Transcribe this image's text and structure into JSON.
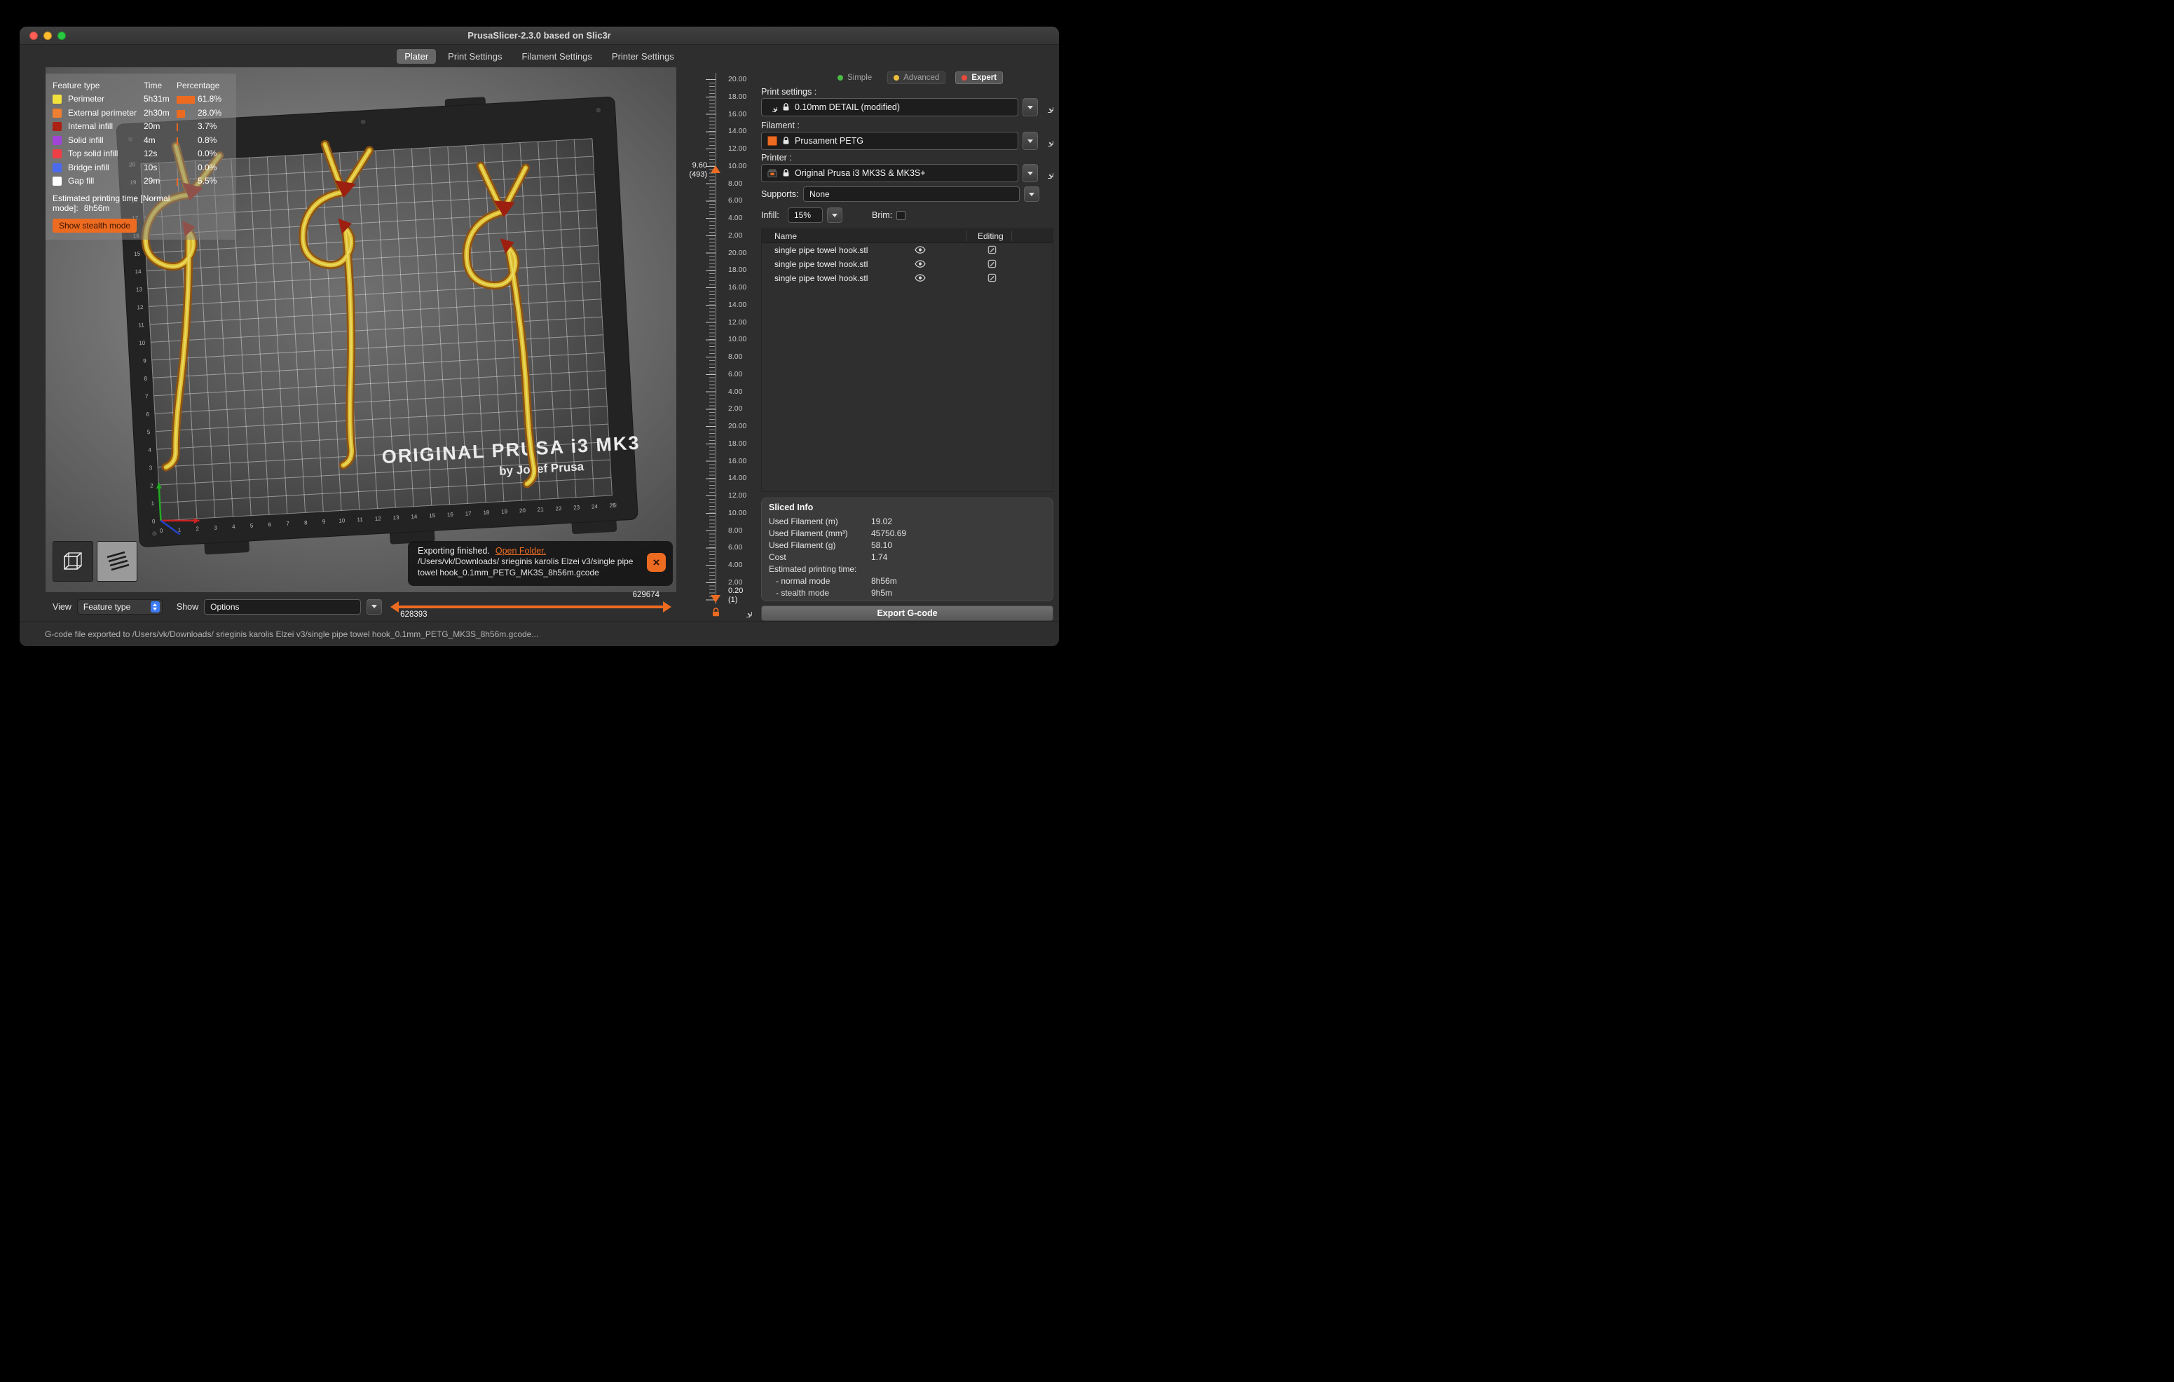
{
  "accent_color": "#ED6B21",
  "window": {
    "title": "PrusaSlicer-2.3.0 based on Slic3r",
    "status_bar": "G-code file exported to /Users/vk/Downloads/ srieginis karolis Elzei v3/single pipe towel hook_0.1mm_PETG_MK3S_8h56m.gcode..."
  },
  "tabs": [
    {
      "label": "Plater"
    },
    {
      "label": "Print Settings"
    },
    {
      "label": "Filament Settings"
    },
    {
      "label": "Printer Settings"
    }
  ],
  "legend": {
    "header": {
      "feature": "Feature type",
      "time": "Time",
      "percentage": "Percentage"
    },
    "rows": [
      {
        "name": "Perimeter",
        "color": "#f2e23c",
        "time": "5h31m",
        "pct": "61.8%",
        "bar": 61.8
      },
      {
        "name": "External perimeter",
        "color": "#ee7e31",
        "time": "2h30m",
        "pct": "28.0%",
        "bar": 28.0
      },
      {
        "name": "Internal infill",
        "color": "#ab2114",
        "time": "20m",
        "pct": "3.7%",
        "bar": 3.7
      },
      {
        "name": "Solid infill",
        "color": "#a144d8",
        "time": "4m",
        "pct": "0.8%",
        "bar": 0.8
      },
      {
        "name": "Top solid infill",
        "color": "#f03e46",
        "time": "12s",
        "pct": "0.0%",
        "bar": 0
      },
      {
        "name": "Bridge infill",
        "color": "#4a6af0",
        "time": "10s",
        "pct": "0.0%",
        "bar": 0
      },
      {
        "name": "Gap fill",
        "color": "#ffffff",
        "time": "29m",
        "pct": "5.5%",
        "bar": 5.5
      }
    ],
    "estimate_label": "Estimated printing time [Normal mode]:",
    "estimate_value": "8h56m",
    "stealth_button": "Show stealth mode"
  },
  "bed": {
    "brand_line1": "ORIGINAL PRUSA i3 MK3",
    "brand_line2": "by Josef Prusa",
    "x_axis_labels": [
      "0",
      "1",
      "2",
      "3",
      "4",
      "5",
      "6",
      "7",
      "8",
      "9",
      "10",
      "11",
      "12",
      "13",
      "14",
      "15",
      "16",
      "17",
      "18",
      "19",
      "20",
      "21",
      "22",
      "23",
      "24",
      "25"
    ],
    "y_axis_labels": [
      "0",
      "1",
      "2",
      "3",
      "4",
      "5",
      "6",
      "7",
      "8",
      "9",
      "10",
      "11",
      "12",
      "13",
      "14",
      "15",
      "16",
      "17",
      "18",
      "19",
      "20"
    ]
  },
  "export_toast": {
    "status": "Exporting finished.",
    "link": "Open Folder.",
    "path_line1": "/Users/vk/Downloads/ srieginis karolis Elzei v3/single pipe",
    "path_line2": "towel hook_0.1mm_PETG_MK3S_8h56m.gcode",
    "close_glyph": "×"
  },
  "bottom_bar": {
    "view_label": "View",
    "view_value": "Feature type",
    "show_label": "Show",
    "show_value": "Options",
    "range_start": "628393",
    "range_end": "629674"
  },
  "layer_slider": {
    "tick_labels": [
      "20.00",
      "18.00",
      "16.00",
      "14.00",
      "12.00",
      "10.00",
      "8.00",
      "6.00",
      "4.00",
      "2.00",
      "20.00",
      "18.00",
      "16.00",
      "14.00",
      "12.00",
      "10.00",
      "8.00",
      "6.00",
      "4.00",
      "2.00",
      "20.00",
      "18.00",
      "16.00",
      "14.00",
      "12.00",
      "10.00",
      "8.00",
      "6.00",
      "4.00",
      "2.00"
    ],
    "upper_value": "9.60",
    "upper_layer": "(493)",
    "lower_value": "0.20",
    "lower_layer": "(1)"
  },
  "sidebar": {
    "modes": [
      {
        "label": "Simple",
        "color": "#4cb944"
      },
      {
        "label": "Advanced",
        "color": "#edbe3c"
      },
      {
        "label": "Expert",
        "color": "#e84a3c"
      }
    ],
    "print_settings_label": "Print settings :",
    "print_settings_value": "0.10mm DETAIL (modified)",
    "filament_label": "Filament :",
    "filament_value": "Prusament PETG",
    "filament_color": "#ED6B21",
    "printer_label": "Printer :",
    "printer_value": "Original Prusa i3 MK3S & MK3S+",
    "supports_label": "Supports:",
    "supports_value": "None",
    "infill_label": "Infill:",
    "infill_value": "15%",
    "brim_label": "Brim:",
    "table": {
      "name_header": "Name",
      "editing_header": "Editing",
      "rows": [
        "single pipe towel hook.stl",
        "single pipe towel hook.stl",
        "single pipe towel hook.stl"
      ]
    },
    "sliced_info": {
      "title": "Sliced Info",
      "items": [
        {
          "label": "Used Filament (m)",
          "value": "19.02"
        },
        {
          "label": "Used Filament (mm³)",
          "value": "45750.69"
        },
        {
          "label": "Used Filament (g)",
          "value": "58.10"
        },
        {
          "label": "Cost",
          "value": "1.74"
        },
        {
          "label": "Estimated printing time:",
          "value": ""
        },
        {
          "label": "- normal mode",
          "value": "8h56m"
        },
        {
          "label": "- stealth mode",
          "value": "9h5m"
        }
      ]
    },
    "export_button": "Export G-code"
  }
}
